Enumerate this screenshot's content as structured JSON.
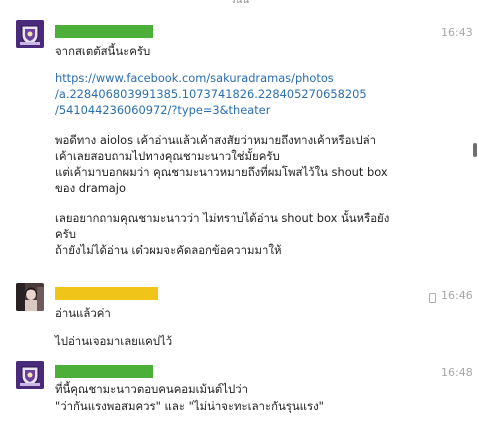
{
  "top_fragment": "วนน",
  "messages": [
    {
      "time": "16:43",
      "lines": {
        "intro": "จากสเตตัสนี้นะครับ",
        "url1": "https://www.facebook.com/sakuradramas/photos",
        "url2": "/a.228406803991385.1073741826.228405270658205",
        "url3": "/541044236060972/?type=3&theater",
        "p1": "พอดีทาง aiolos เค้าอ่านแล้วเค้าสงสัยว่าหมายถึงทางเค้าหรือเปล่า",
        "p2": "เค้าเลยสอบถามไปทางคุณชามะนาวใช่มั้ยครับ",
        "p3": "แต่เค้ามาบอกผมว่า คุณชามะนาวหมายถึงที่ผมโพสไว้ใน shout box",
        "p4": "ของ dramajo",
        "p5": "เลยอยากถามคุณชามะนาวว่า ไม่ทราบได้อ่าน shout box นั้นหรือยัง",
        "p6": "ครับ",
        "p7": "ถ้ายังไม่ได้อ่าน เด๋วผมจะคัดลอกข้อความมาให้"
      }
    },
    {
      "time": "16:46",
      "lines": {
        "l1": "อ่านแล้วค่า",
        "l2": "ไปอ่านเจอมาเลยแคปไว้"
      }
    },
    {
      "time": "16:48",
      "lines": {
        "l1": "ที่นี้คุณชามะนาวตอบคนคอมเม้นต์ไปว่า",
        "l2": "\"ว่ากันแรงพอสมควร\" และ \"ไม่น่าจะทะเลาะกันรุนแรง\""
      }
    }
  ],
  "icons": [
    "school-crest-avatar-icon",
    "user-photo-avatar-icon",
    "mobile-phone-icon"
  ],
  "colors": {
    "name_bar_green": "#4caf3a",
    "name_bar_yellow": "#f0c419",
    "link": "#2a6fb0",
    "timestamp": "#a8a8a8"
  }
}
